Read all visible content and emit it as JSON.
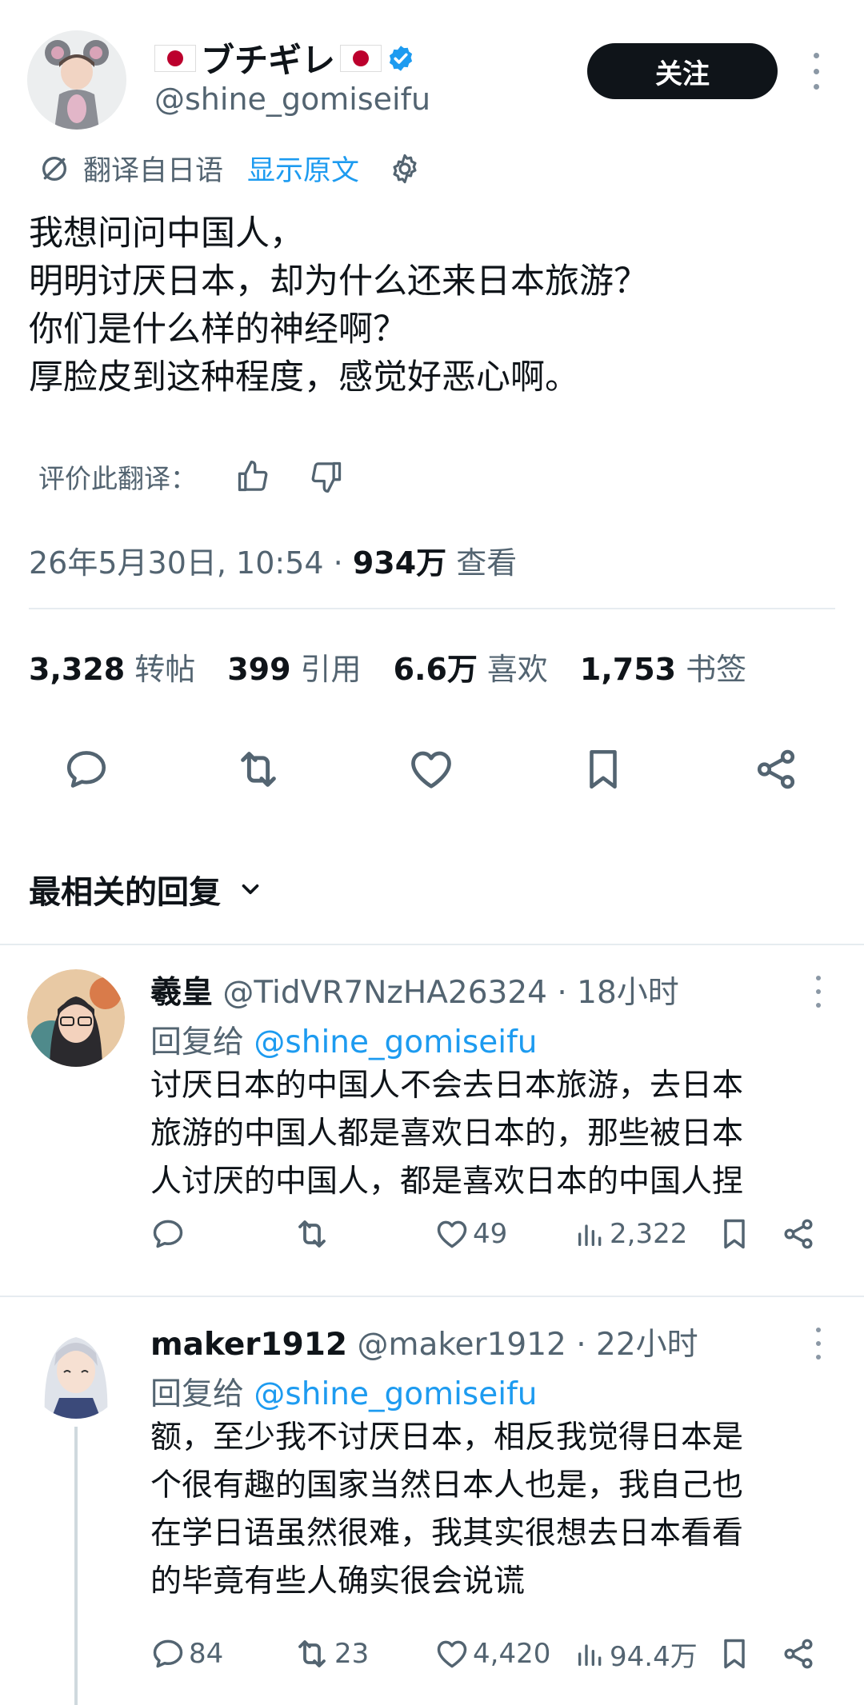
{
  "tweet": {
    "display_name": "ブチギレ",
    "handle": "@shine_gomiseifu",
    "follow_label": "关注",
    "translate_label": "翻译自日语",
    "show_original_label": "显示原文",
    "text_lines": [
      "我想问问中国人，",
      "明明讨厌日本，却为什么还来日本旅游？",
      "你们是什么样的神经啊？",
      "厚脸皮到这种程度，感觉好恶心啊。"
    ],
    "rate_label": "评价此翻译：",
    "date_time": "26年5月30日, 10:54",
    "separator": " · ",
    "views_count": "934万",
    "views_label": " 查看"
  },
  "stats": [
    {
      "count": "3,328",
      "label": "转帖"
    },
    {
      "count": "399",
      "label": "引用"
    },
    {
      "count": "6.6万",
      "label": "喜欢"
    },
    {
      "count": "1,753",
      "label": "书签"
    }
  ],
  "actions": [
    "reply-icon",
    "retweet-icon",
    "like-icon",
    "bookmark-icon",
    "share-icon"
  ],
  "sort": {
    "label": "最相关的回复"
  },
  "replies": [
    {
      "name": "羲皇",
      "handle": "@TidVR7NzHA26324",
      "time": " · 18小时",
      "reply_to_label": "回复给 ",
      "reply_to_handle": "@shine_gomiseifu",
      "body_lines": [
        "讨厌日本的中国人不会去日本旅游，去日本",
        "旅游的中国人都是喜欢日本的，那些被日本",
        "人讨厌的中国人，都是喜欢日本的中国人捏"
      ],
      "replies_count": "",
      "retweets_count": "",
      "likes_count": "49",
      "views_count": "2,322"
    },
    {
      "name": "maker1912",
      "handle": " @maker1912",
      "time": " · 22小时",
      "reply_to_label": "回复给 ",
      "reply_to_handle": "@shine_gomiseifu",
      "body_lines": [
        "额，至少我不讨厌日本，相反我觉得日本是",
        "个很有趣的国家当然日本人也是，我自己也",
        "在学日语虽然很难，我其实很想去日本看看",
        "的毕竟有些人确实很会说谎"
      ],
      "replies_count": "84",
      "retweets_count": "23",
      "likes_count": "4,420",
      "views_count": "94.4万"
    }
  ],
  "colors": {
    "accent": "#1d9bf0",
    "muted": "#536471",
    "text": "#0f1419",
    "flag_red": "#bc002d"
  }
}
